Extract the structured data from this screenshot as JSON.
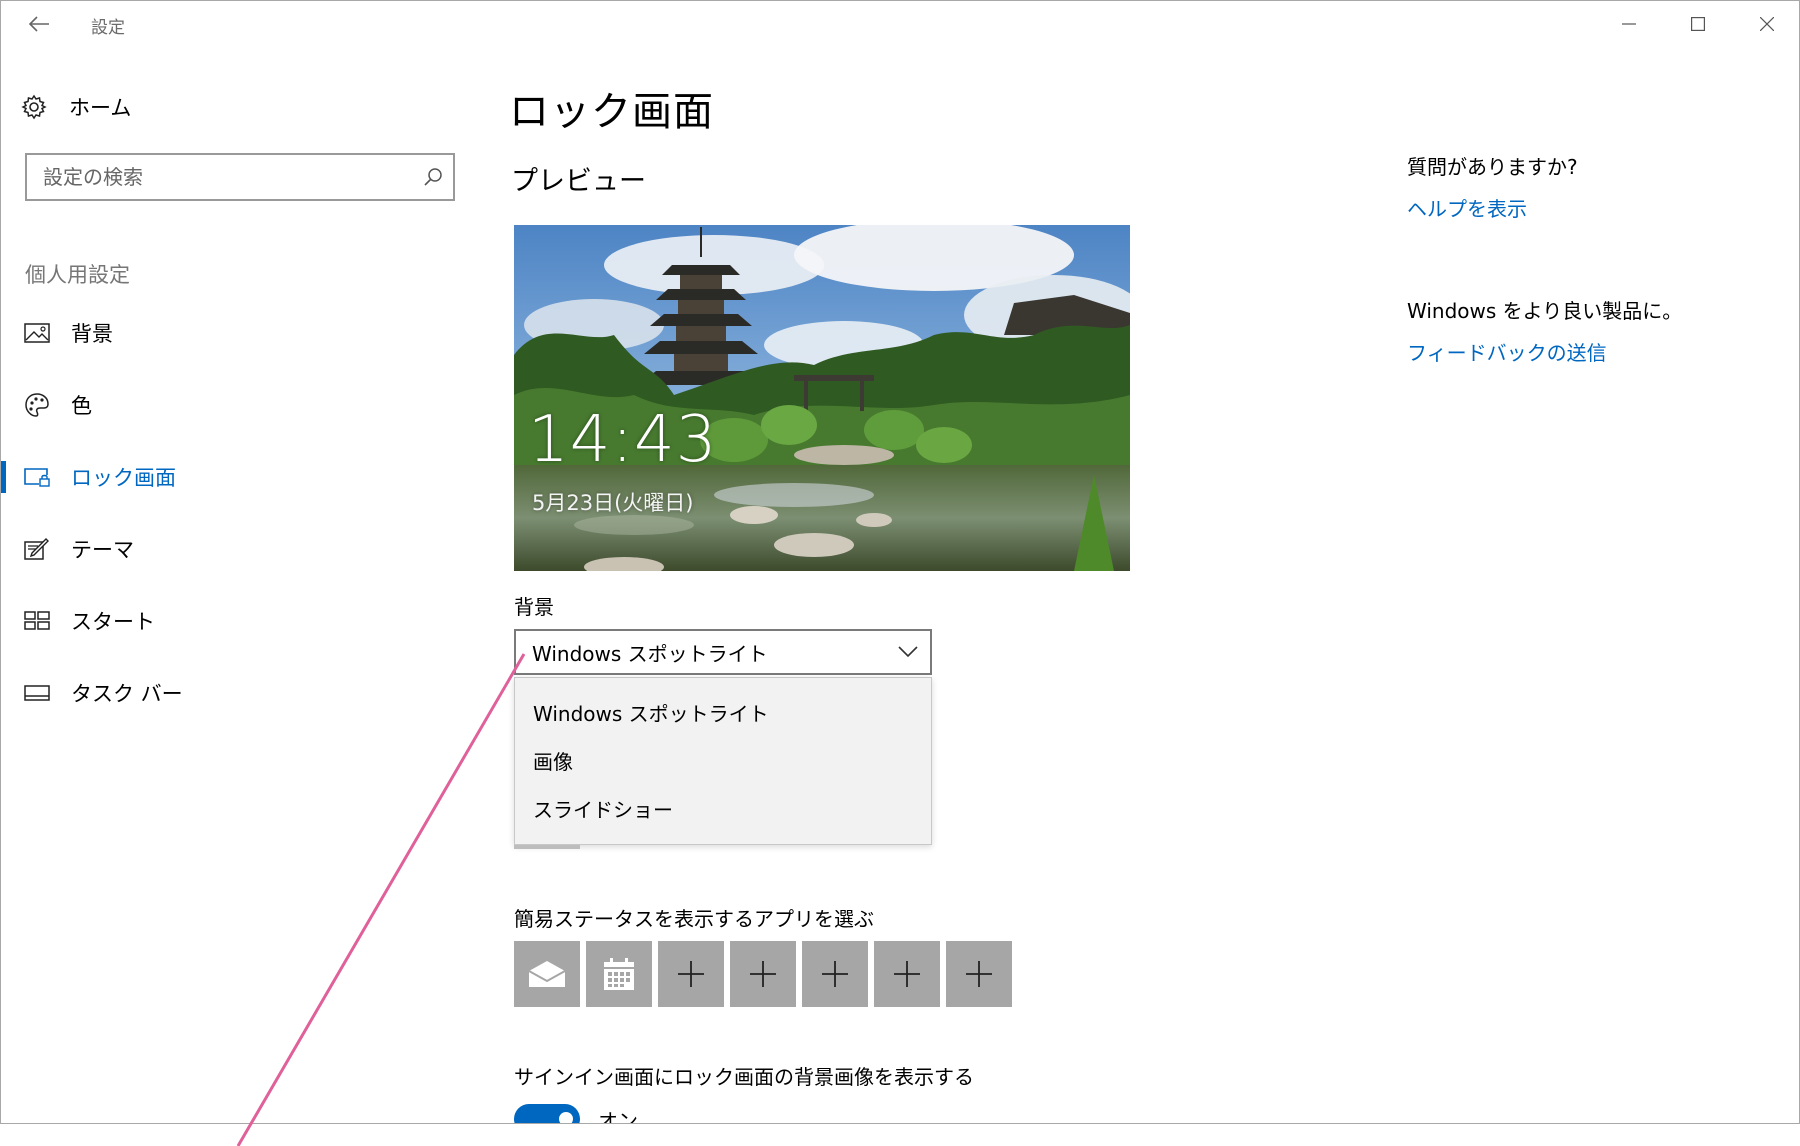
{
  "window": {
    "title": "設定",
    "controls": [
      "minimize",
      "maximize",
      "close"
    ]
  },
  "sidebar": {
    "home_label": "ホーム",
    "search_placeholder": "設定の検索",
    "section_heading": "個人用設定",
    "items": [
      {
        "label": "背景",
        "icon": "picture-icon",
        "active": false
      },
      {
        "label": "色",
        "icon": "palette-icon",
        "active": false
      },
      {
        "label": "ロック画面",
        "icon": "lock-screen-icon",
        "active": true
      },
      {
        "label": "テーマ",
        "icon": "theme-icon",
        "active": false
      },
      {
        "label": "スタート",
        "icon": "start-icon",
        "active": false
      },
      {
        "label": "タスク バー",
        "icon": "taskbar-icon",
        "active": false
      }
    ]
  },
  "main": {
    "title": "ロック画面",
    "preview_heading": "プレビュー",
    "preview": {
      "time": "14:43",
      "date": "5月23日(火曜日)"
    },
    "background_label": "背景",
    "background_dropdown": {
      "selected": "Windows スポットライト",
      "options": [
        "Windows スポットライト",
        "画像",
        "スライドショー"
      ]
    },
    "quick_status_label": "簡易ステータスを表示するアプリを選ぶ",
    "quick_status_tiles": [
      "mail-icon",
      "calendar-icon",
      "plus-icon",
      "plus-icon",
      "plus-icon",
      "plus-icon",
      "plus-icon"
    ],
    "signin_label": "サインイン画面にロック画面の背景画像を表示する",
    "signin_toggle": {
      "state": "オン",
      "on": true
    }
  },
  "right_column": {
    "question": "質問がありますか?",
    "help_link": "ヘルプを表示",
    "feedback_text": "Windows をより良い製品に。",
    "feedback_link": "フィードバックの送信"
  },
  "colors": {
    "accent": "#0067c0",
    "annotation_line": "#e0609a",
    "tile": "#a6a6a6"
  }
}
